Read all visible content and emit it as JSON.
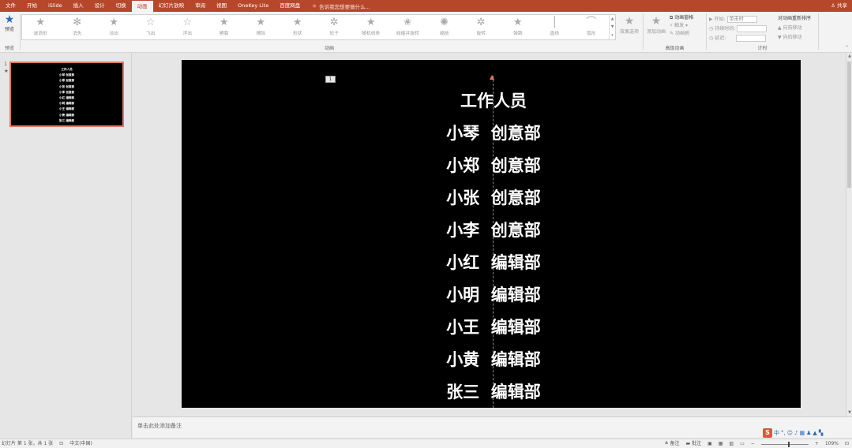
{
  "tabs": [
    "文件",
    "开始",
    "iSlide",
    "插入",
    "设计",
    "切换",
    "动画",
    "幻灯片放映",
    "审阅",
    "视图",
    "OneKey Lite",
    "百度网盘"
  ],
  "active_tab_index": 6,
  "tell_me": "告诉我您想要做什么...",
  "share_label": "共享",
  "preview": {
    "label": "预览",
    "group": "预览"
  },
  "animation_gallery": {
    "items": [
      "波浪形",
      "消失",
      "淡出",
      "飞出",
      "浮出",
      "劈裂",
      "擦除",
      "形状",
      "轮子",
      "随机线条",
      "收缩并旋转",
      "缩放",
      "旋转",
      "弹跳",
      "直线",
      "弧形"
    ],
    "group": "动画"
  },
  "effect_options_label": "效果选项",
  "add_animation_label": "添加动画",
  "advanced": {
    "pane": "动画窗格",
    "trigger": "触发",
    "painter": "动画刷",
    "group": "高级动画"
  },
  "timing": {
    "start_label": "开始:",
    "start_value": "单击时",
    "duration_label": "持续时间:",
    "delay_label": "延迟:",
    "group": "计时"
  },
  "reorder": {
    "title": "对动画重新排序",
    "earlier": "向前移动",
    "later": "向后移动"
  },
  "slide_panel": {
    "number": "1",
    "star": "★"
  },
  "thumbnail_lines": [
    "工作人员",
    "小琴 创意部",
    "小郑 创意部",
    "小张 创意部",
    "小李 创意部",
    "小红 编辑部",
    "小明 编辑部",
    "小王 编辑部",
    "小黄 编辑部",
    "张三 编辑部"
  ],
  "slide": {
    "anim_tag": "1",
    "lines": [
      "工作人员",
      "小琴  创意部",
      "小郑  创意部",
      "小张  创意部",
      "小李  创意部",
      "小红  编辑部",
      "小明  编辑部",
      "小王  编辑部",
      "小黄  编辑部",
      "张三  编辑部"
    ]
  },
  "notes_placeholder": "单击此处添加备注",
  "ime": {
    "logo": "S",
    "mode": "中"
  },
  "status": {
    "slide_info": "幻灯片 第 1 张，共 1 张",
    "language": "中文(中国)",
    "notes_btn": "备注",
    "comments_btn": "批注",
    "zoom": "109%"
  }
}
